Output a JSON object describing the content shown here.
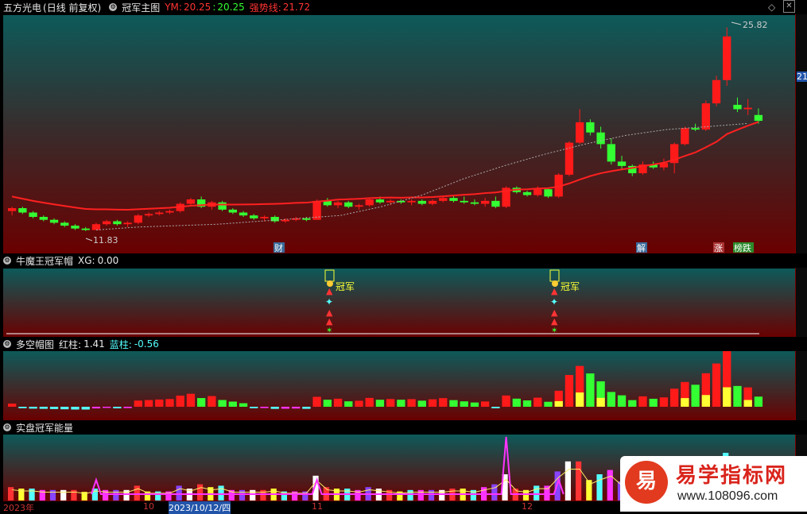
{
  "main": {
    "stock_name": "五方光电",
    "period": "(日线 前复权)",
    "indicator_name": "冠军主图",
    "ym_label": "YM:",
    "ym_value1": "20.25",
    "ym_sep": ":",
    "ym_value2": "20.25",
    "strong_label": "强势线:",
    "strong_value": "21.72",
    "high_label": "25.82",
    "low_label": "11.83",
    "price_axis_label": "21",
    "markers": [
      "财",
      "解",
      "涨",
      "榜跌"
    ]
  },
  "sub1": {
    "name": "牛魔王冠军帽",
    "xg_label": "XG:",
    "xg_value": "0.00",
    "signal_label": "冠军"
  },
  "sub2": {
    "name": "多空帽图",
    "red_label": "红柱:",
    "red_value": "1.41",
    "blue_label": "蓝柱:",
    "blue_value": "-0.56"
  },
  "sub3": {
    "name": "实盘冠军能量"
  },
  "xaxis": {
    "labels": [
      "2023年",
      "10",
      "2023/10/12/四",
      "11",
      "12"
    ]
  },
  "watermark": {
    "char": "易",
    "title": "易学指标网",
    "url": "www.108096.com"
  },
  "colors": {
    "up": "#ff1a1a",
    "down": "#33ff33",
    "cyan": "#55ffff",
    "yellow": "#ffff33",
    "magenta": "#ff33ff",
    "ma_line": "#ff2020"
  },
  "chart_data": {
    "type": "candlestick",
    "title": "五方光电 (日线 前复权)",
    "ohlc": [
      [
        13.2,
        13.5,
        12.9,
        13.4
      ],
      [
        13.4,
        13.5,
        13.0,
        13.1
      ],
      [
        13.1,
        13.2,
        12.7,
        12.8
      ],
      [
        12.8,
        12.9,
        12.5,
        12.6
      ],
      [
        12.6,
        12.7,
        12.3,
        12.4
      ],
      [
        12.4,
        12.5,
        12.1,
        12.2
      ],
      [
        12.2,
        12.3,
        11.9,
        12.0
      ],
      [
        12.0,
        12.1,
        11.83,
        11.9
      ],
      [
        11.9,
        12.4,
        11.9,
        12.3
      ],
      [
        12.3,
        12.6,
        12.2,
        12.5
      ],
      [
        12.5,
        12.6,
        12.2,
        12.3
      ],
      [
        12.3,
        12.5,
        12.1,
        12.4
      ],
      [
        12.4,
        13.0,
        12.3,
        12.9
      ],
      [
        12.9,
        13.1,
        12.8,
        13.0
      ],
      [
        13.0,
        13.2,
        12.9,
        13.1
      ],
      [
        13.1,
        13.3,
        13.0,
        13.2
      ],
      [
        13.2,
        13.8,
        13.1,
        13.7
      ],
      [
        13.7,
        14.1,
        13.6,
        14.0
      ],
      [
        14.0,
        14.2,
        13.4,
        13.5
      ],
      [
        13.5,
        13.9,
        13.3,
        13.8
      ],
      [
        13.8,
        13.9,
        13.2,
        13.3
      ],
      [
        13.3,
        13.4,
        13.0,
        13.1
      ],
      [
        13.1,
        13.2,
        12.8,
        12.9
      ],
      [
        12.9,
        13.0,
        12.6,
        12.7
      ],
      [
        12.7,
        12.9,
        12.5,
        12.8
      ],
      [
        12.8,
        12.9,
        12.4,
        12.5
      ],
      [
        12.5,
        12.7,
        12.4,
        12.6
      ],
      [
        12.6,
        12.8,
        12.5,
        12.7
      ],
      [
        12.7,
        12.8,
        12.5,
        12.6
      ],
      [
        12.6,
        14.0,
        12.6,
        13.9
      ],
      [
        13.9,
        14.1,
        13.5,
        13.6
      ],
      [
        13.6,
        13.9,
        13.4,
        13.8
      ],
      [
        13.8,
        13.9,
        13.4,
        13.5
      ],
      [
        13.5,
        13.7,
        13.3,
        13.6
      ],
      [
        13.6,
        14.1,
        13.5,
        14.0
      ],
      [
        14.0,
        14.2,
        13.7,
        13.8
      ],
      [
        13.8,
        14.0,
        13.6,
        13.9
      ],
      [
        13.9,
        14.0,
        13.7,
        13.8
      ],
      [
        13.8,
        14.0,
        13.6,
        13.9
      ],
      [
        13.9,
        14.0,
        13.6,
        13.7
      ],
      [
        13.7,
        14.0,
        13.6,
        13.9
      ],
      [
        13.9,
        14.2,
        13.8,
        14.1
      ],
      [
        14.1,
        14.3,
        13.8,
        13.9
      ],
      [
        13.9,
        14.2,
        13.7,
        13.8
      ],
      [
        13.8,
        14.0,
        13.6,
        13.7
      ],
      [
        13.7,
        14.1,
        13.5,
        13.9
      ],
      [
        13.9,
        14.2,
        13.4,
        13.5
      ],
      [
        13.5,
        14.9,
        13.4,
        14.8
      ],
      [
        14.8,
        14.9,
        14.4,
        14.5
      ],
      [
        14.5,
        14.6,
        14.2,
        14.3
      ],
      [
        14.3,
        14.9,
        14.2,
        14.7
      ],
      [
        14.7,
        14.8,
        14.1,
        14.2
      ],
      [
        14.2,
        15.8,
        14.1,
        15.7
      ],
      [
        15.7,
        18.0,
        15.6,
        17.9
      ],
      [
        17.9,
        20.2,
        17.8,
        19.3
      ],
      [
        19.3,
        19.5,
        18.4,
        18.6
      ],
      [
        18.6,
        19.0,
        17.5,
        17.8
      ],
      [
        17.8,
        18.2,
        16.4,
        16.6
      ],
      [
        16.6,
        17.0,
        16.0,
        16.3
      ],
      [
        16.3,
        16.4,
        15.6,
        15.8
      ],
      [
        15.8,
        16.6,
        15.7,
        16.4
      ],
      [
        16.4,
        16.6,
        16.1,
        16.2
      ],
      [
        16.2,
        16.8,
        16.0,
        16.5
      ],
      [
        16.5,
        17.9,
        15.8,
        17.8
      ],
      [
        17.8,
        19.0,
        17.7,
        18.9
      ],
      [
        18.9,
        19.2,
        18.7,
        18.8
      ],
      [
        18.8,
        20.8,
        18.7,
        20.6
      ],
      [
        20.6,
        22.5,
        20.4,
        22.2
      ],
      [
        22.2,
        25.82,
        21.8,
        25.2
      ],
      [
        20.5,
        21.0,
        20.0,
        20.2
      ],
      [
        20.2,
        20.9,
        19.8,
        20.3
      ],
      [
        19.8,
        20.25,
        19.2,
        19.4
      ]
    ],
    "strong_line": [
      14.4,
      14.6,
      14.7,
      14.8,
      15.0,
      15.2,
      15.4,
      16.0,
      16.8,
      17.9,
      18.8,
      19.6,
      20.3,
      20.9,
      21.3,
      21.5,
      21.72
    ],
    "ylim": [
      11.0,
      26.5
    ],
    "high_mark": 25.82,
    "low_mark": 11.83,
    "xlabel": "",
    "ylabel": ""
  }
}
